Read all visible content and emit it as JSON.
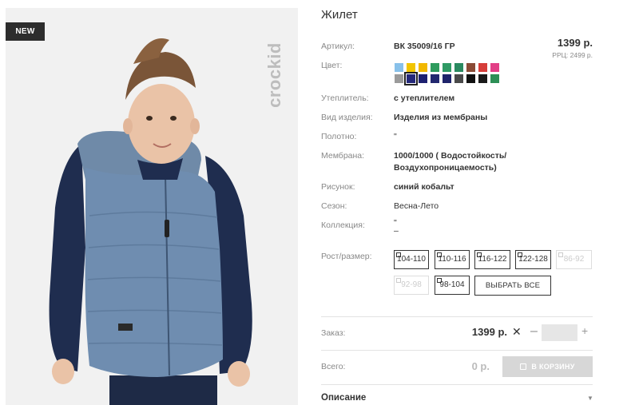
{
  "badge": "NEW",
  "brand": "crockid",
  "product": {
    "title": "Жилет",
    "price": "1399 р.",
    "rrp": "РРЦ: 2499 р."
  },
  "labels": {
    "article": "Артикул:",
    "color": "Цвет:",
    "insulation": "Утеплитель:",
    "type": "Вид изделия:",
    "fabric": "Полотно:",
    "membrane": "Мембрана:",
    "pattern": "Рисунок:",
    "season": "Сезон:",
    "collection": "Коллекция:",
    "size": "Рост/размер:"
  },
  "values": {
    "article": "ВК 35009/16 ГР",
    "insulation": "с утеплителем",
    "type": "Изделия из мембраны",
    "fabric": "\"",
    "membrane_1": "1000/1000 ( Водостойкость/",
    "membrane_2": "Воздухопроницаемость)",
    "pattern": "синий кобальт",
    "season": "Весна-Лето",
    "collection_1": "\"",
    "collection_2": "–"
  },
  "colors": {
    "row1": [
      "#88c1ea",
      "#f2c500",
      "#f2b800",
      "#2e9b5d",
      "#2f9a64",
      "#2a8a60",
      "#8a4b36",
      "#d63e3a",
      "#e23f86"
    ],
    "row2": [
      "#9b9b9b",
      "#24287a",
      "#1d2070",
      "#23286f",
      "#1f246b",
      "#4a4a4a",
      "#111111",
      "#1a1a1a",
      "#2d8f56"
    ],
    "selected_index_row2": 1
  },
  "sizes": [
    {
      "label": "104-110",
      "available": true
    },
    {
      "label": "110-116",
      "available": true
    },
    {
      "label": "116-122",
      "available": true
    },
    {
      "label": "122-128",
      "available": true
    },
    {
      "label": "86-92",
      "available": false
    },
    {
      "label": "92-98",
      "available": false
    },
    {
      "label": "98-104",
      "available": true
    }
  ],
  "select_all": "ВЫБРАТЬ ВСЕ",
  "order": {
    "label": "Заказ:",
    "price": "1399 р.",
    "times": "✕",
    "minus": "–",
    "plus": "+",
    "qty_value": ""
  },
  "total": {
    "label": "Всего:",
    "value": "0 р.",
    "cart_button": "В КОРЗИНУ"
  },
  "description": {
    "label": "Описание",
    "arrow": "▼"
  }
}
